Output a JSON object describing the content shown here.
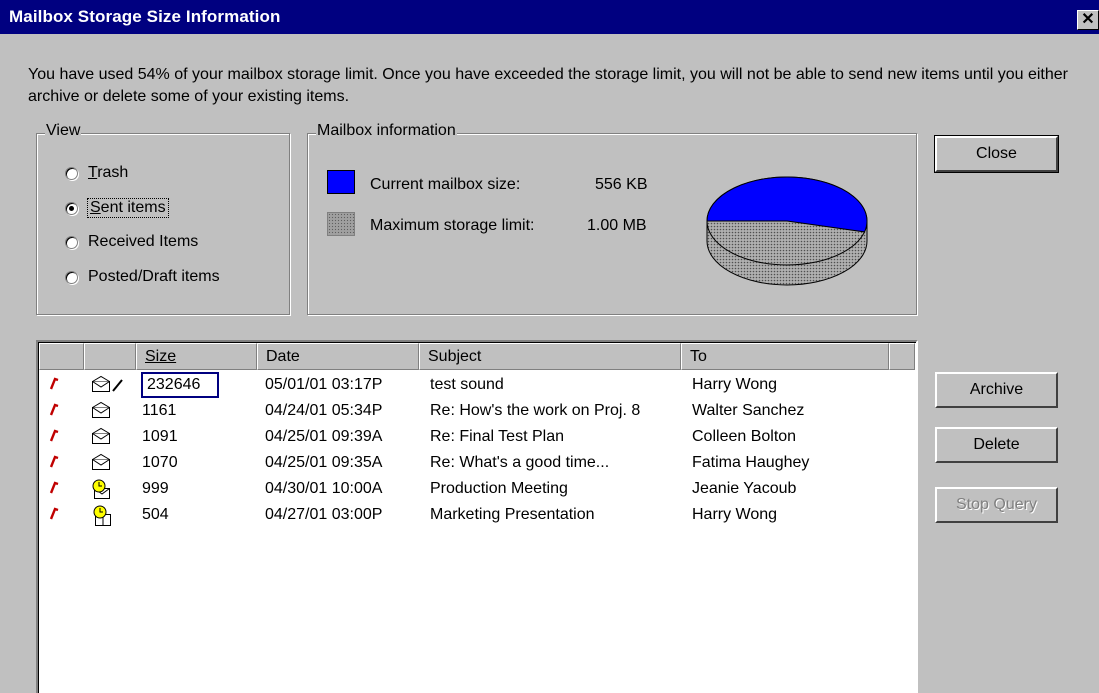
{
  "window": {
    "title": "Mailbox Storage Size Information",
    "close_glyph": "✕"
  },
  "message": "You have used 54% of your mailbox storage limit.  Once you have exceeded the storage limit, you will not be able to send new items until you either archive or delete some of your existing items.",
  "view": {
    "legend": "View",
    "options": [
      {
        "prefix": "",
        "accel": "T",
        "rest": "rash",
        "checked": false
      },
      {
        "prefix": "",
        "accel": "S",
        "rest": "ent items",
        "checked": true
      },
      {
        "prefix": "Received Items",
        "accel": "",
        "rest": "",
        "checked": false
      },
      {
        "prefix": "Posted/Draft items",
        "accel": "",
        "rest": "",
        "checked": false
      }
    ]
  },
  "mailbox_info": {
    "legend": "Mailbox information",
    "current_label": "Current mailbox size:",
    "current_value": "556 KB",
    "max_label": "Maximum storage limit:",
    "max_value": "1.00 MB",
    "used_fraction": 0.54,
    "used_color": "#0000ff",
    "free_color": "#a0a0a0"
  },
  "buttons": {
    "close": "Close",
    "archive": "Archive",
    "delete": "Delete",
    "stop_query": "Stop Query"
  },
  "table": {
    "columns": [
      "",
      "",
      "Size",
      "Date",
      "Subject",
      "To",
      ""
    ],
    "rows": [
      {
        "icon": "envelope-edit-icon",
        "size": "232646",
        "date": "05/01/01 03:17P",
        "subject": "test sound",
        "to": "Harry Wong"
      },
      {
        "icon": "envelope-icon",
        "size": "1161",
        "date": "04/24/01 05:34P",
        "subject": "Re: How's the work on Proj. 8",
        "to": "Walter Sanchez"
      },
      {
        "icon": "envelope-icon",
        "size": "1091",
        "date": "04/25/01 09:39A",
        "subject": "Re: Final Test Plan",
        "to": "Colleen Bolton"
      },
      {
        "icon": "envelope-icon",
        "size": "1070",
        "date": "04/25/01 09:35A",
        "subject": "Re: What's a good time...",
        "to": "Fatima Haughey"
      },
      {
        "icon": "meeting-request-icon",
        "size": "999",
        "date": "04/30/01 10:00A",
        "subject": "Production Meeting",
        "to": "Jeanie Yacoub"
      },
      {
        "icon": "meeting-icon",
        "size": "504",
        "date": "04/27/01 03:00P",
        "subject": "Marketing Presentation",
        "to": "Harry Wong"
      }
    ]
  }
}
